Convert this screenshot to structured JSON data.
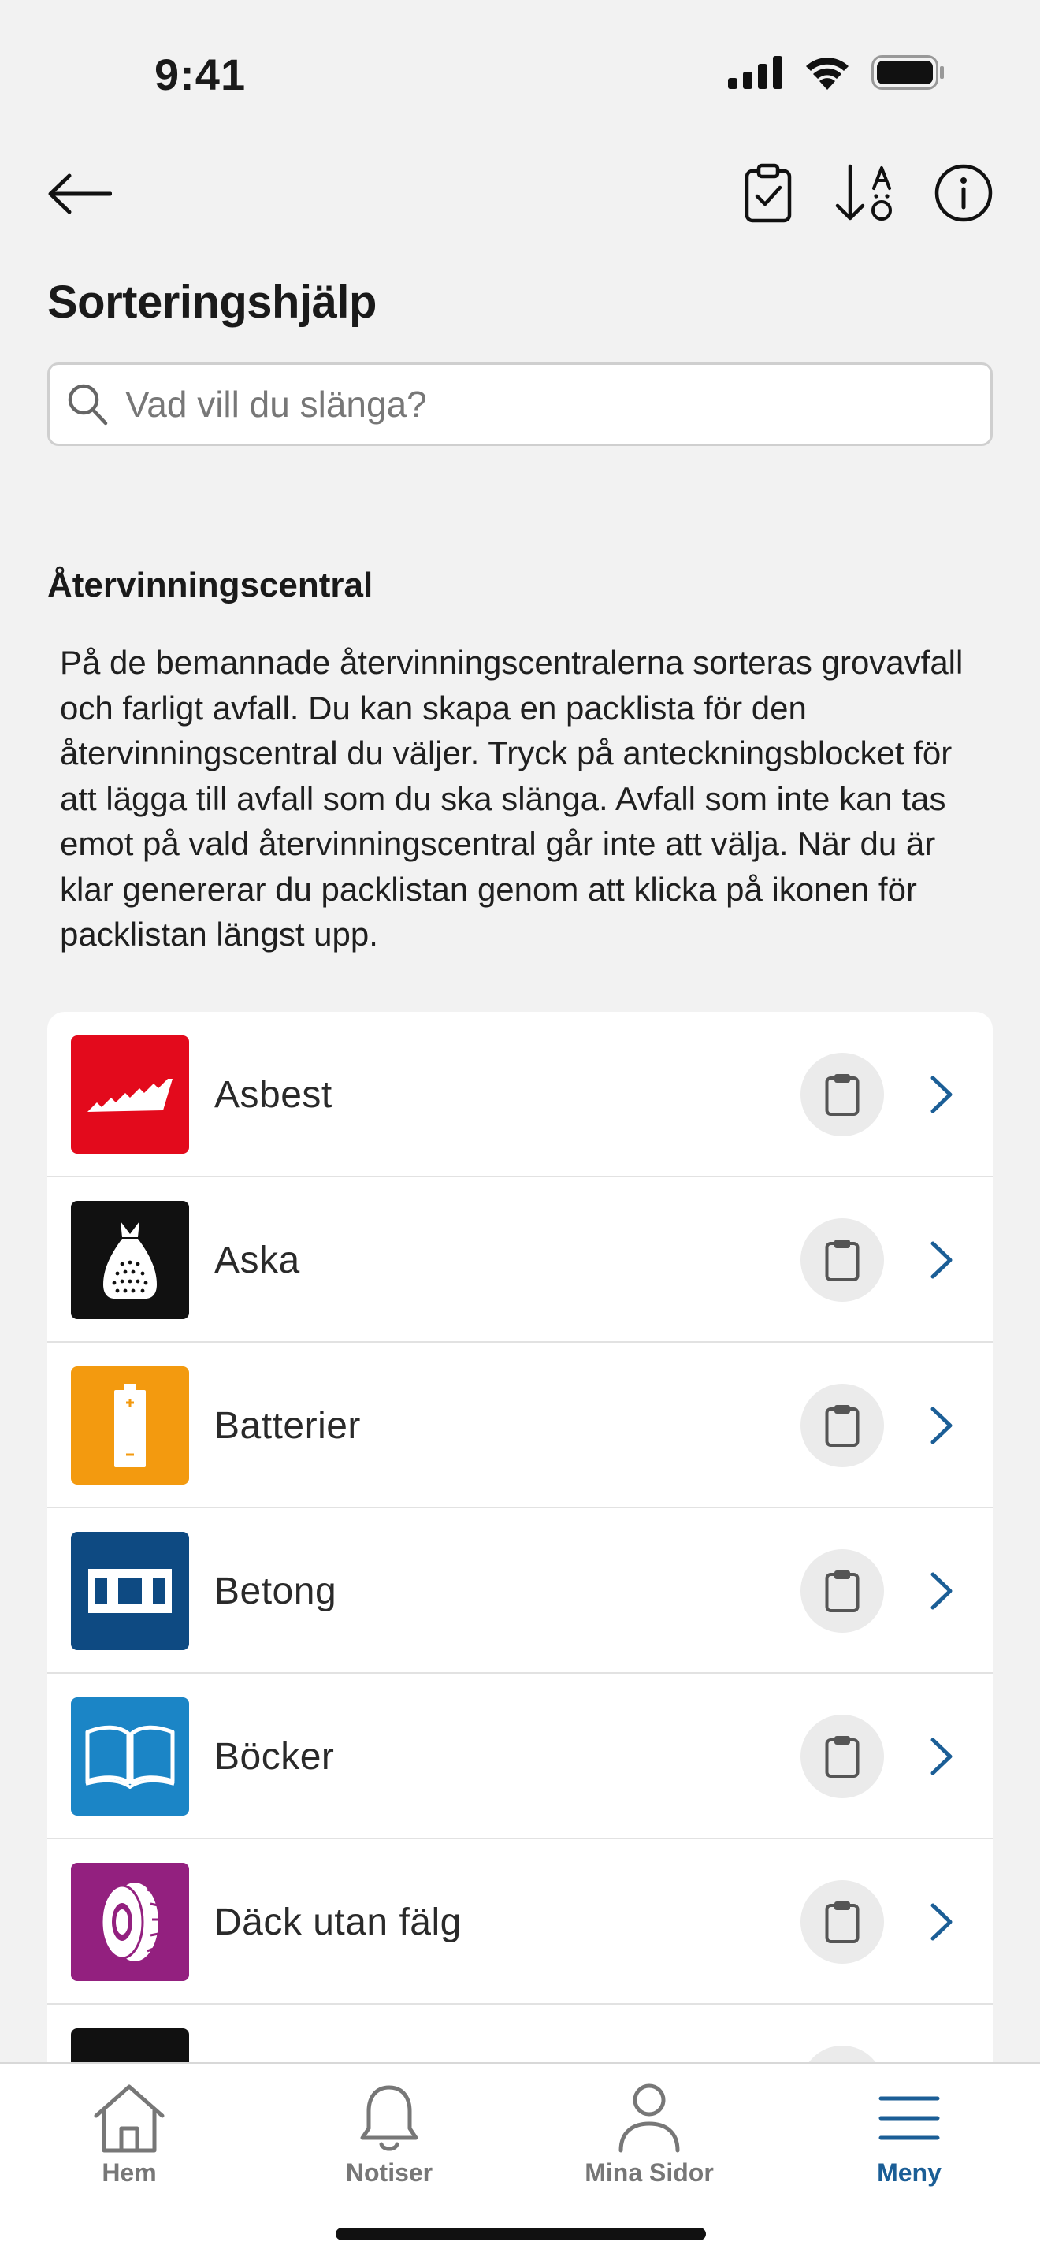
{
  "status": {
    "time": "9:41"
  },
  "page": {
    "title": "Sorteringshjälp"
  },
  "search": {
    "placeholder": "Vad vill du slänga?"
  },
  "section": {
    "title": "Återvinningscentral",
    "description": "På de bemannade återvinningscentralerna sorteras grovavfall och farligt avfall. Du kan skapa en packlista för den återvinningscentral du väljer. Tryck på anteckningsblocket för att lägga till avfall som du ska slänga. Avfall som inte kan tas emot på vald återvinningscentral går inte att välja. När du är klar genererar du packlistan genom att klicka på ikonen för packlistan längst upp."
  },
  "items": [
    {
      "label": "Asbest",
      "icon": "asbestos-icon",
      "color": "#e30a1c"
    },
    {
      "label": "Aska",
      "icon": "ash-bag-icon",
      "color": "#111111"
    },
    {
      "label": "Batterier",
      "icon": "battery-icon",
      "color": "#f39a0f"
    },
    {
      "label": "Betong",
      "icon": "concrete-beam-icon",
      "color": "#0e4a82"
    },
    {
      "label": "Böcker",
      "icon": "book-icon",
      "color": "#1b85c6"
    },
    {
      "label": "Däck utan fälg",
      "icon": "tire-icon",
      "color": "#93207f"
    },
    {
      "label": "",
      "icon": "partial-icon",
      "color": "#111111"
    }
  ],
  "tabbar": {
    "tabs": [
      {
        "label": "Hem",
        "icon": "home-icon"
      },
      {
        "label": "Notiser",
        "icon": "bell-icon"
      },
      {
        "label": "Mina Sidor",
        "icon": "person-icon"
      },
      {
        "label": "Meny",
        "icon": "menu-icon",
        "active": true
      }
    ]
  },
  "colors": {
    "accent": "#1b5e96",
    "background": "#f2f2f2"
  }
}
